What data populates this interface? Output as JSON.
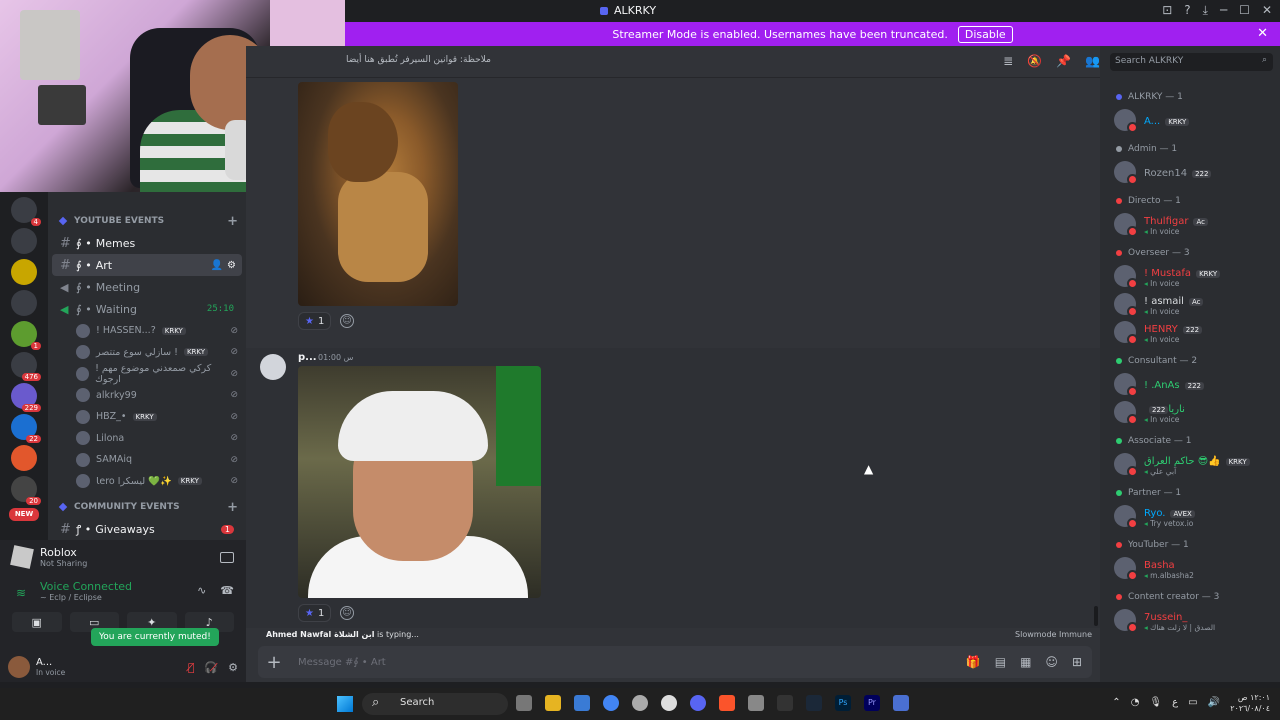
{
  "window": {
    "title": "ALKRKY",
    "controls": [
      "⊡",
      "?",
      "⤓",
      "─",
      "☐",
      "✕"
    ]
  },
  "banner": {
    "text": "Streamer Mode is enabled. Usernames have been truncated.",
    "disable_label": "Disable",
    "close": "✕"
  },
  "servers": {
    "badges": [
      "4",
      "1",
      "476",
      "229",
      "22",
      "20"
    ],
    "new_label": "NEW"
  },
  "channels": {
    "categories": [
      {
        "label": "YOUTUBE EVENTS",
        "plus": "+"
      },
      {
        "label": "COMMUNITY EVENTS",
        "plus": "+"
      }
    ],
    "items": [
      {
        "label": "Memes",
        "prefix": "#",
        "emoji": "∮ •"
      },
      {
        "label": "Art",
        "prefix": "#",
        "emoji": "∮ •"
      },
      {
        "label": "Meeting",
        "emoji": "∮ •"
      },
      {
        "label": "Waiting",
        "emoji": "∮ •",
        "timer": "25:10"
      },
      {
        "label": "Giveaways",
        "prefix": "#",
        "emoji": "ꝭ •",
        "badge": "1"
      }
    ],
    "voice_users": [
      {
        "name": "! HASSEN...?",
        "tag": "KRKY"
      },
      {
        "name": "سازلي سوع متتصر !",
        "tag": "KRKY"
      },
      {
        "name": "! كركي صمعدني موضوع مهم ارجوك",
        "tag": ""
      },
      {
        "name": "alkrky99",
        "tag": ""
      },
      {
        "name": "HBZ_•",
        "tag": "KRKY"
      },
      {
        "name": "Lilona",
        "tag": ""
      },
      {
        "name": "SAMAiq",
        "tag": ""
      },
      {
        "name": "Ɩero ليسكرا 💚✨",
        "tag": "KRKY"
      }
    ]
  },
  "activity": {
    "name": "Roblox",
    "sub": "Not Sharing"
  },
  "voice": {
    "status": "Voice Connected",
    "channel": "~ Eclp / Eclipse",
    "toast": "You are currently muted!"
  },
  "user": {
    "name": "A...",
    "status": "In voice"
  },
  "header": {
    "topic": "ملاحظة: قوانين السيرفر تُطبق هنا أيضا"
  },
  "messages": {
    "reaction_count_1": "1",
    "msg2_author": "p...",
    "msg2_time": "س 01:00",
    "reaction_count_2": "1"
  },
  "typing": {
    "who": "Ahmed Nawfal ابن الشلاة",
    "suffix": "is typing..."
  },
  "slowmode": "Slowmode Immune",
  "composer": {
    "placeholder": "Message #∮ • Art"
  },
  "members_search": {
    "placeholder": "Search ALKRKY"
  },
  "roles": [
    {
      "label": "ALKRKY — 1",
      "color": "#5865f2",
      "members": [
        {
          "name": "A...",
          "color": "#00a8fc",
          "tag": "KRKY",
          "status": ""
        }
      ]
    },
    {
      "label": "Admin — 1",
      "color": "#949ba4",
      "members": [
        {
          "name": "Rozen14",
          "color": "#949ba4",
          "tag": "222",
          "status": ""
        }
      ]
    },
    {
      "label": "Directo — 1",
      "color": "#f23f42",
      "members": [
        {
          "name": "Thulfigar",
          "color": "#f23f42",
          "tag": "Ac",
          "status": "In voice"
        }
      ]
    },
    {
      "label": "Overseer — 3",
      "color": "#f23f42",
      "members": [
        {
          "name": "! Mustafa",
          "color": "#f23f42",
          "tag": "KRKY",
          "status": "In voice"
        },
        {
          "name": "! asmail",
          "color": "#dbdee1",
          "tag": "Ac",
          "status": "In voice"
        },
        {
          "name": "HENRY",
          "color": "#f23f42",
          "tag": "222",
          "status": "In voice"
        }
      ]
    },
    {
      "label": "Consultant — 2",
      "color": "#2ecc71",
      "members": [
        {
          "name": "! .AnAs",
          "color": "#2ecc71",
          "tag": "222",
          "status": ""
        },
        {
          "name": "ناريا",
          "color": "#2ecc71",
          "tag": "222",
          "status": "In voice"
        }
      ]
    },
    {
      "label": "Associate — 1",
      "color": "#2ecc71",
      "members": [
        {
          "name": "حاكم العراق 😎👍",
          "color": "#2ecc71",
          "tag": "KRKY",
          "status": "آبي علي"
        }
      ]
    },
    {
      "label": "Partner — 1",
      "color": "#2ecc71",
      "members": [
        {
          "name": "Ryo.",
          "color": "#00a8fc",
          "tag": "AVEX",
          "status": "Try vetox.io"
        }
      ]
    },
    {
      "label": "YouTuber — 1",
      "color": "#f23f42",
      "members": [
        {
          "name": "Basha",
          "color": "#f23f42",
          "tag": "",
          "status": "m.albasha2"
        }
      ]
    },
    {
      "label": "Content creator — 3",
      "color": "#f23f42",
      "members": [
        {
          "name": "7ussein_",
          "color": "#f23f42",
          "tag": "",
          "status": "الصدق | لا زلت هناك"
        }
      ]
    }
  ],
  "taskbar": {
    "search_label": "Search",
    "clock_time": "١٢:٠١ ص",
    "clock_date": "٢٠٢٦/٠٨/٠٤",
    "lang": "ع"
  }
}
